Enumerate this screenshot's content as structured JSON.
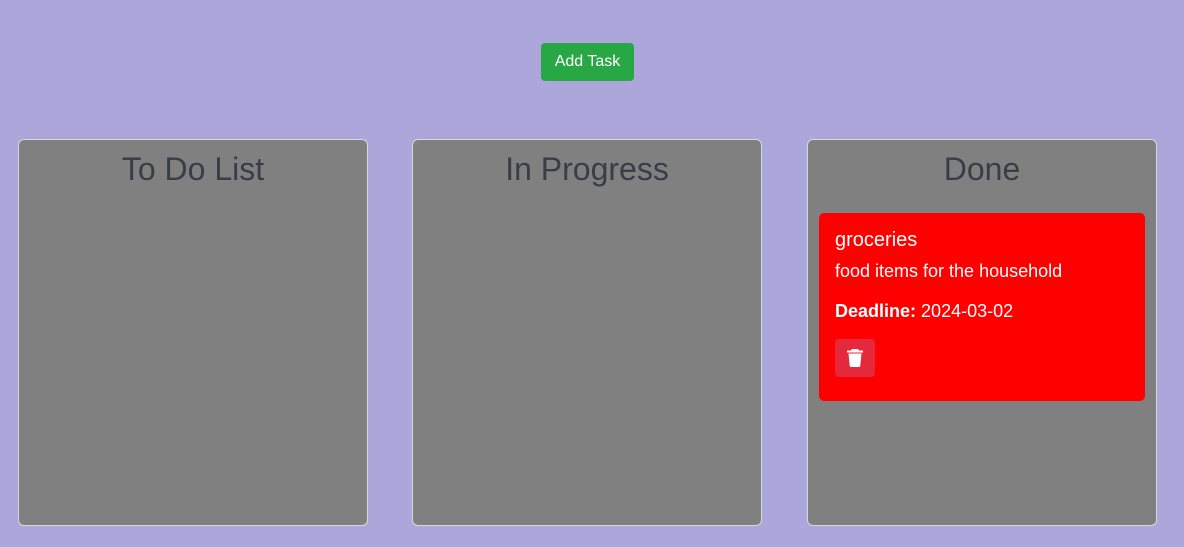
{
  "toolbar": {
    "add_task_label": "Add Task"
  },
  "lanes": [
    {
      "title": "To Do List"
    },
    {
      "title": "In Progress"
    },
    {
      "title": "Done"
    }
  ],
  "done_tasks": [
    {
      "title": "groceries",
      "description": "food items for the household",
      "deadline_label": "Deadline:",
      "deadline_value": "2024-03-02",
      "color": "#ff0000",
      "delete_icon": "trash-icon"
    }
  ],
  "colors": {
    "background": "#aca6da",
    "add_button": "#28a745",
    "lane": "#808080",
    "delete_button": "#e4293c"
  }
}
